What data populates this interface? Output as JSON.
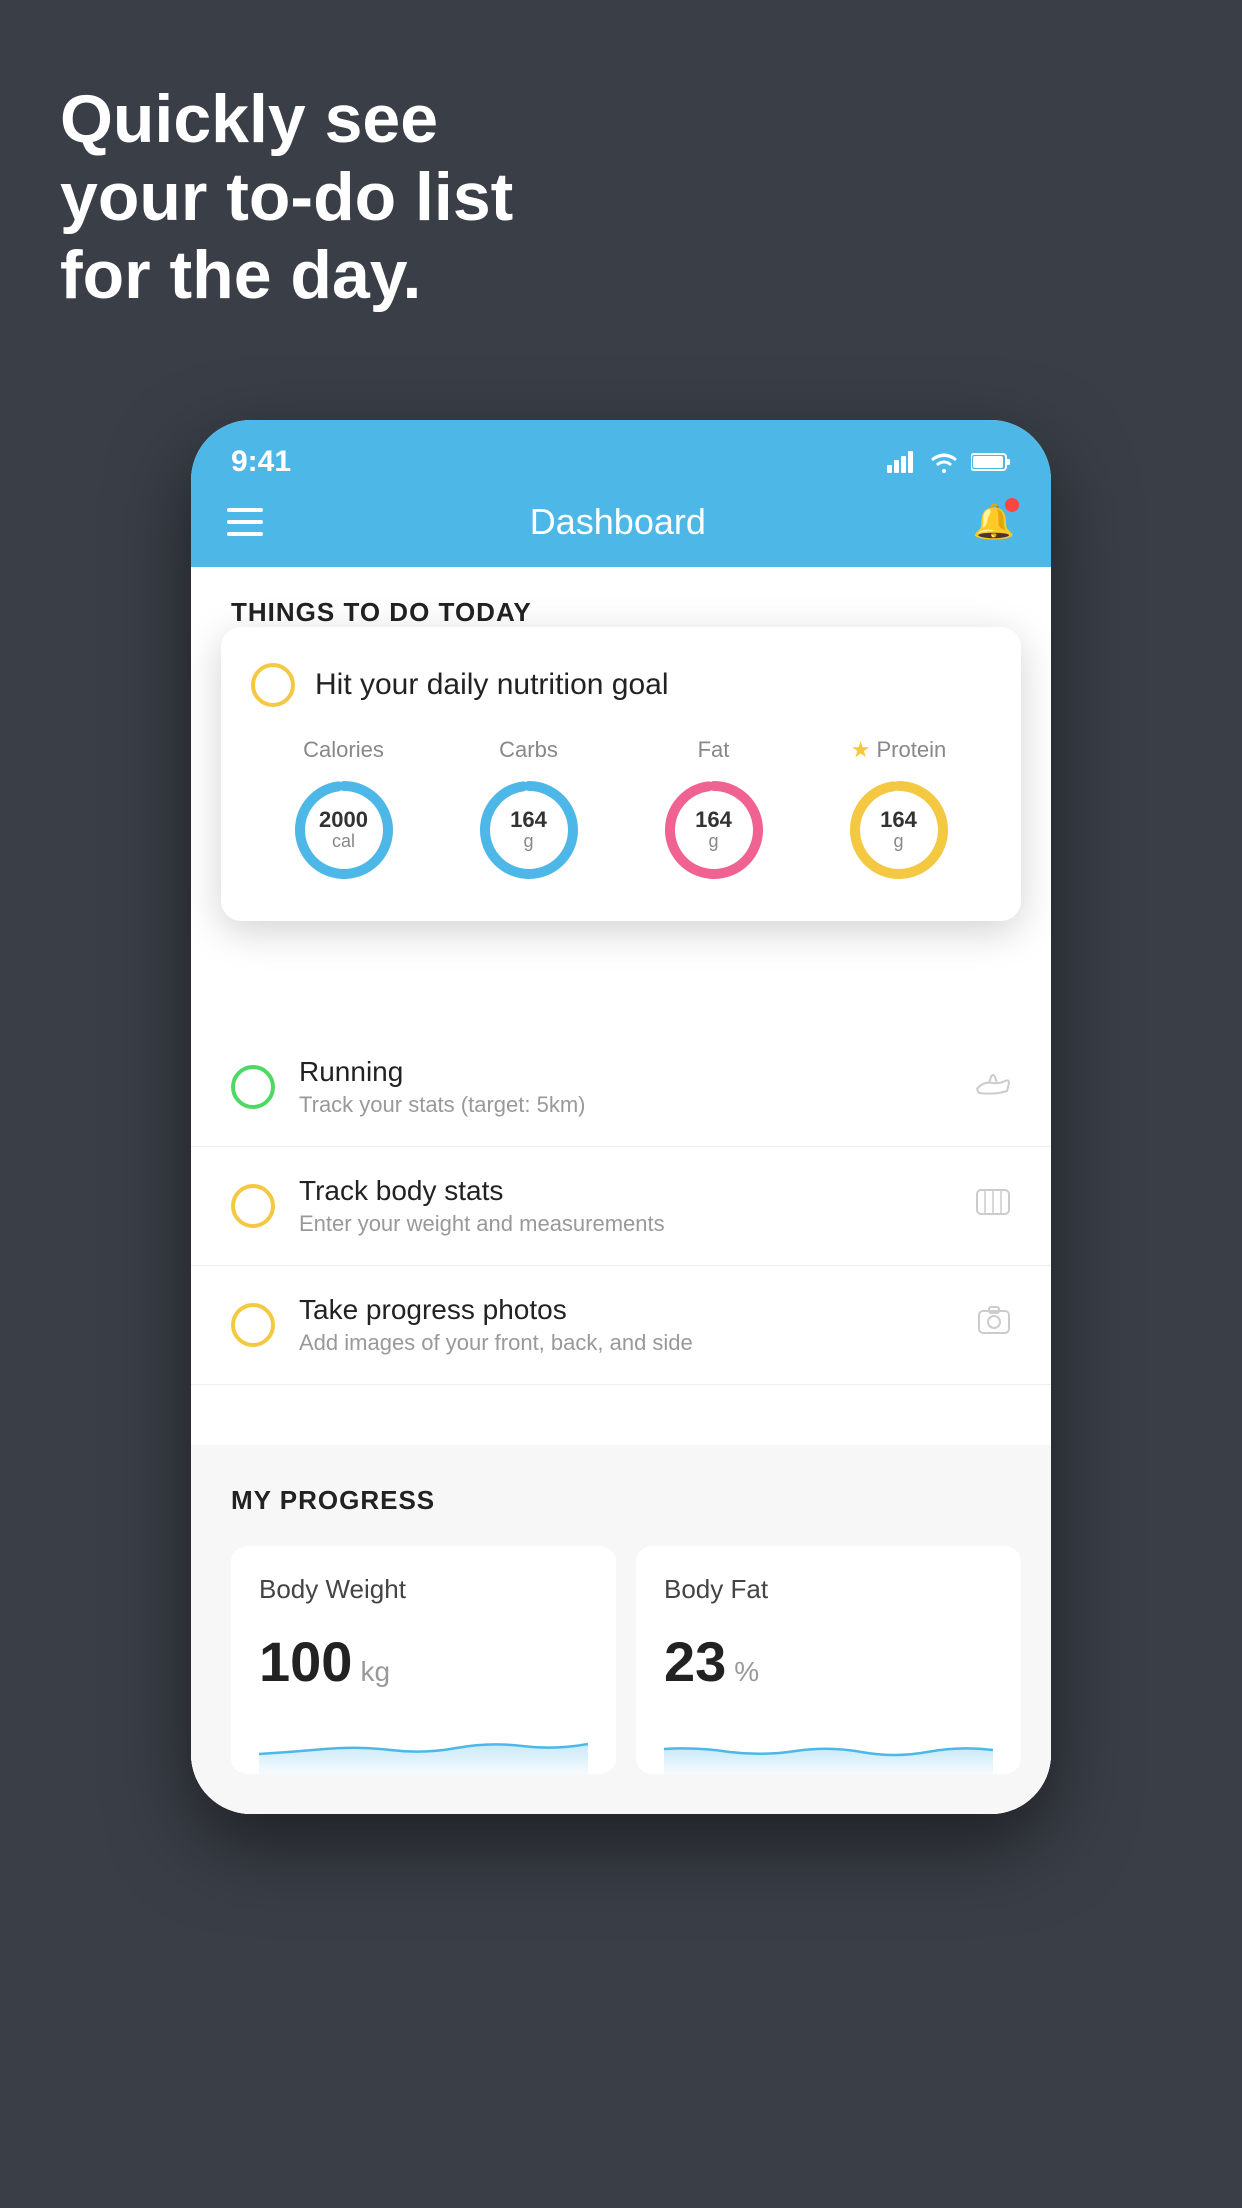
{
  "background_color": "#3a3f47",
  "hero": {
    "title_line1": "Quickly see",
    "title_line2": "your to-do list",
    "title_line3": "for the day."
  },
  "phone": {
    "status_bar": {
      "time": "9:41",
      "signal_icon": "signal-icon",
      "wifi_icon": "wifi-icon",
      "battery_icon": "battery-icon"
    },
    "nav": {
      "title": "Dashboard",
      "hamburger_icon": "hamburger-icon",
      "bell_icon": "bell-icon",
      "has_notification": true
    },
    "things_section": {
      "header": "THINGS TO DO TODAY"
    },
    "nutrition_card": {
      "indicator_color": "#f5c842",
      "title": "Hit your daily nutrition goal",
      "items": [
        {
          "label": "Calories",
          "value": "2000",
          "unit": "cal",
          "color": "#4db8e8",
          "starred": false
        },
        {
          "label": "Carbs",
          "value": "164",
          "unit": "g",
          "color": "#4db8e8",
          "starred": false
        },
        {
          "label": "Fat",
          "value": "164",
          "unit": "g",
          "color": "#f06292",
          "starred": false
        },
        {
          "label": "Protein",
          "value": "164",
          "unit": "g",
          "color": "#f5c842",
          "starred": true
        }
      ]
    },
    "todo_items": [
      {
        "title": "Running",
        "subtitle": "Track your stats (target: 5km)",
        "circle_color": "green",
        "icon": "shoe-icon"
      },
      {
        "title": "Track body stats",
        "subtitle": "Enter your weight and measurements",
        "circle_color": "yellow",
        "icon": "scale-icon"
      },
      {
        "title": "Take progress photos",
        "subtitle": "Add images of your front, back, and side",
        "circle_color": "yellow",
        "icon": "photo-icon"
      }
    ],
    "progress_section": {
      "header": "MY PROGRESS",
      "cards": [
        {
          "title": "Body Weight",
          "value": "100",
          "unit": "kg"
        },
        {
          "title": "Body Fat",
          "value": "23",
          "unit": "%"
        }
      ]
    }
  }
}
